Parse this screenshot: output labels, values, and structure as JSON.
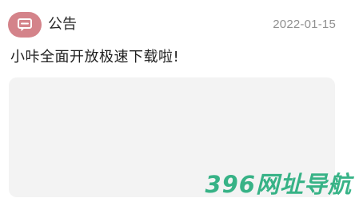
{
  "header": {
    "icon": "message-icon",
    "title": "公告",
    "date": "2022-01-15"
  },
  "message": "小咔全面开放极速下载啦!",
  "watermark": "396网址导航",
  "colors": {
    "icon_bg": "#d4838a",
    "card_bg": "#f3f3f3",
    "watermark": "#1eaa78"
  }
}
